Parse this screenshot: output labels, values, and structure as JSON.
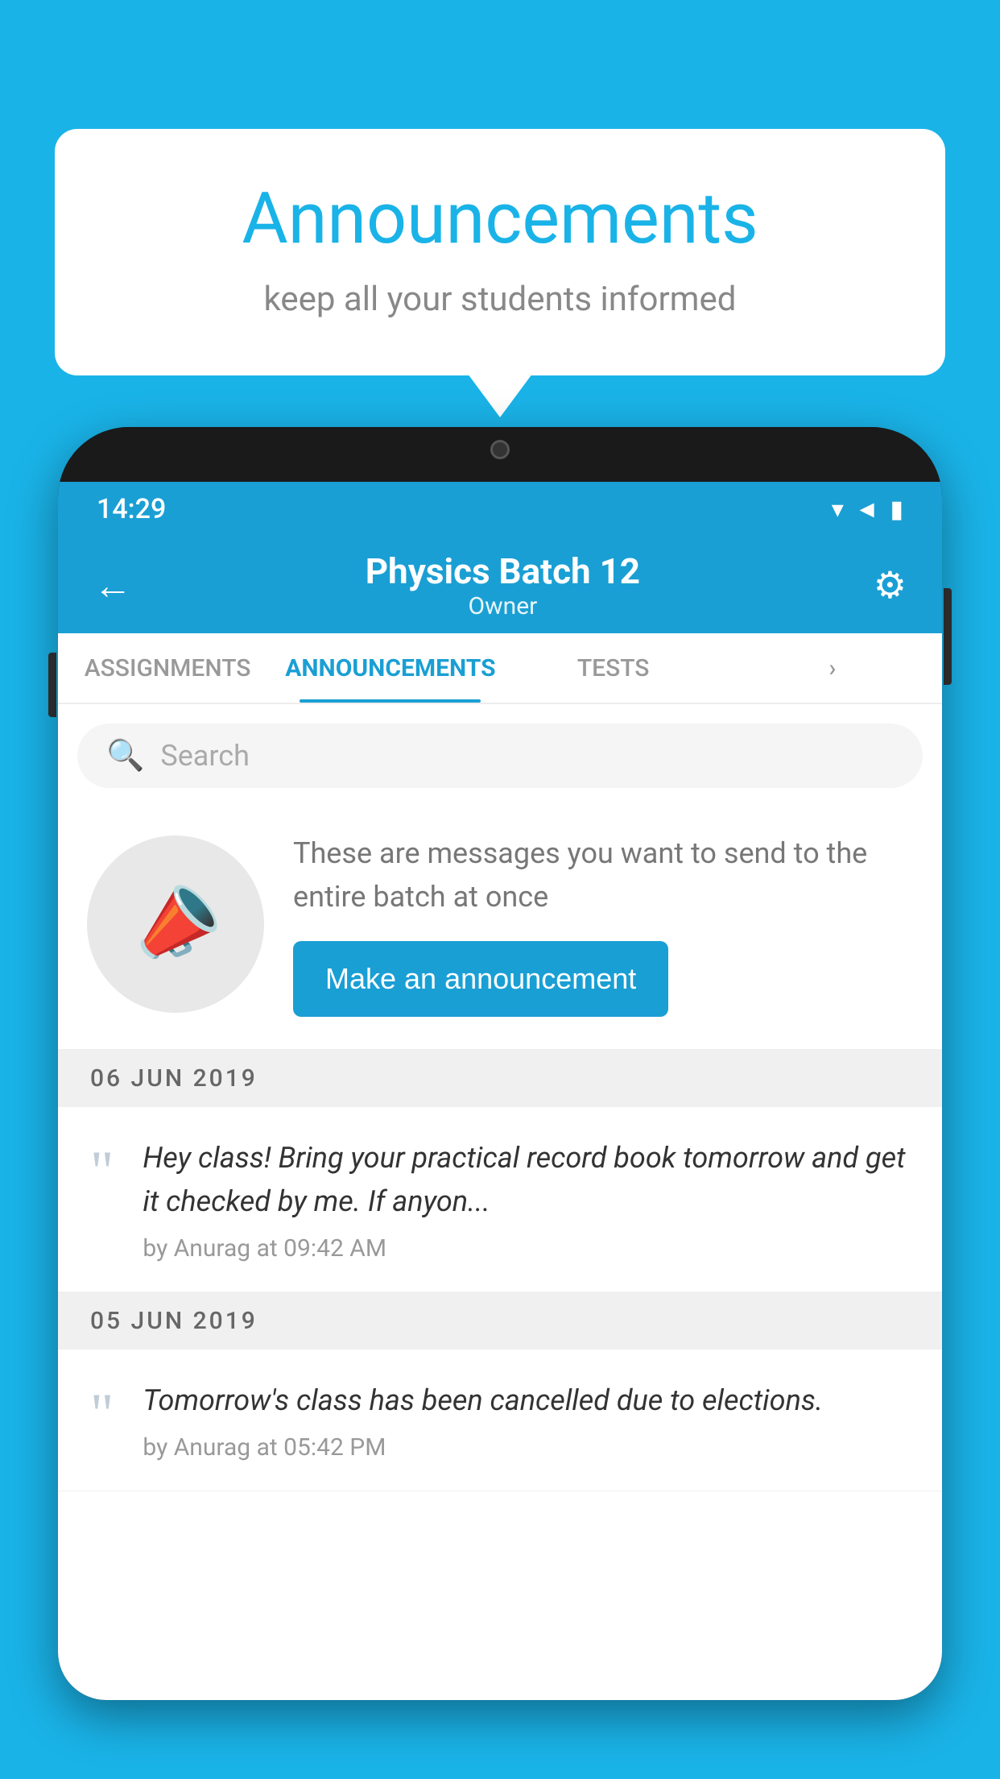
{
  "background_color": "#1ab3e8",
  "speech_bubble": {
    "title": "Announcements",
    "subtitle": "keep all your students informed",
    "title_color": "#1ab3e8"
  },
  "phone": {
    "status_bar": {
      "time": "14:29",
      "icons": [
        "▼",
        "◄",
        "▮"
      ]
    },
    "header": {
      "title": "Physics Batch 12",
      "subtitle": "Owner",
      "back_label": "←",
      "gear_label": "⚙"
    },
    "tabs": [
      {
        "label": "ASSIGNMENTS",
        "active": false
      },
      {
        "label": "ANNOUNCEMENTS",
        "active": true
      },
      {
        "label": "TESTS",
        "active": false
      },
      {
        "label": "›",
        "active": false
      }
    ],
    "search": {
      "placeholder": "Search"
    },
    "promo": {
      "text": "These are messages you want to send to the entire batch at once",
      "button_label": "Make an announcement"
    },
    "date_groups": [
      {
        "date": "06  JUN  2019",
        "announcements": [
          {
            "text": "Hey class! Bring your practical record book tomorrow and get it checked by me. If anyon...",
            "meta": "by Anurag at 09:42 AM"
          }
        ]
      },
      {
        "date": "05  JUN  2019",
        "announcements": [
          {
            "text": "Tomorrow's class has been cancelled due to elections.",
            "meta": "by Anurag at 05:42 PM"
          }
        ]
      }
    ]
  }
}
